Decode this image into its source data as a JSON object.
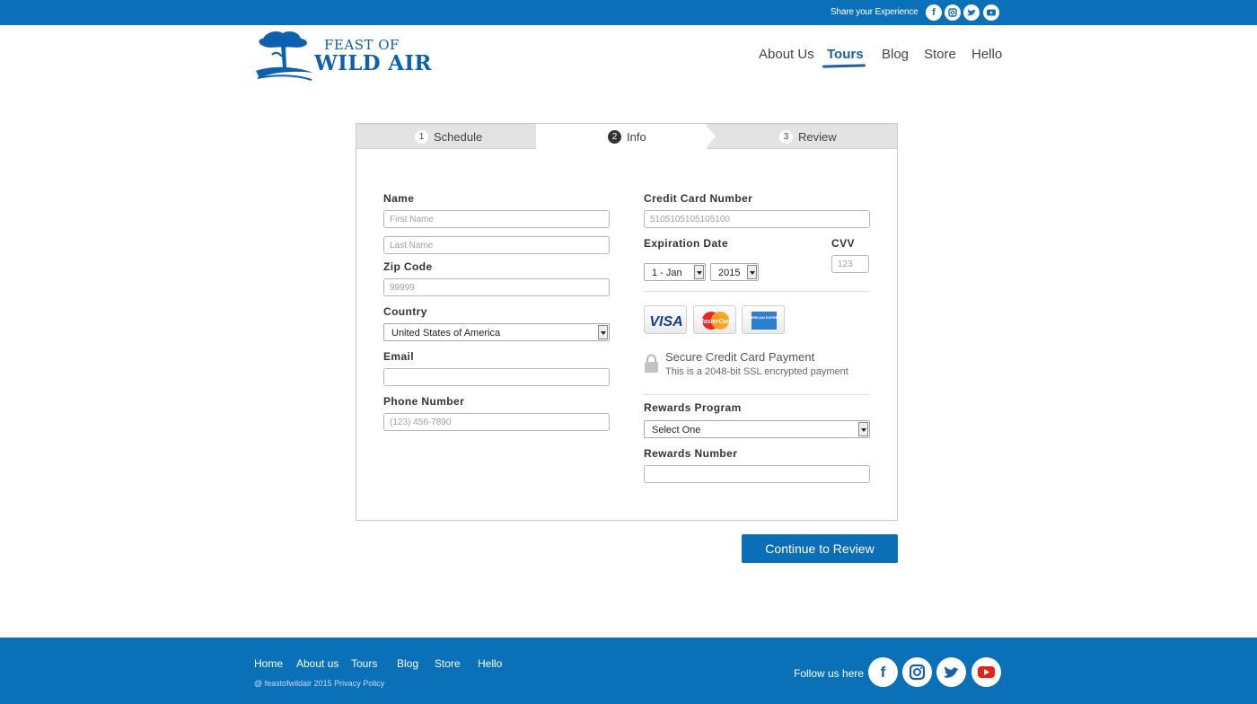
{
  "topbar": {
    "share_text": "Share your Experience",
    "icons": [
      "facebook-icon",
      "instagram-icon",
      "twitter-icon",
      "youtube-icon"
    ]
  },
  "brand": {
    "line1": "FEAST OF",
    "line2": "WILD AIR",
    "color": "#0d5fb0"
  },
  "nav": {
    "items": [
      "About Us",
      "Tours",
      "Blog",
      "Store",
      "Hello"
    ],
    "active": "Tours"
  },
  "steps": [
    {
      "num": "1",
      "label": "Schedule"
    },
    {
      "num": "2",
      "label": "Info",
      "active": true
    },
    {
      "num": "3",
      "label": "Review"
    }
  ],
  "form": {
    "name_label": "Name",
    "first_placeholder": "First Name",
    "last_placeholder": "Last Name",
    "zip_label": "Zip Code",
    "zip_placeholder": "99999",
    "country_label": "Country",
    "country_value": "United States of America",
    "email_label": "Email",
    "email_placeholder": "",
    "phone_label": "Phone Number",
    "phone_placeholder": "(123) 456-7890",
    "cc_label": "Credit Card Number",
    "cc_placeholder": "5105105105105100",
    "exp_label": "Expiration Date",
    "exp_month": "1 - Jan",
    "exp_year": "2015",
    "cvv_label": "CVV",
    "cvv_placeholder": "123",
    "cards": {
      "visa": "VISA",
      "mastercard": "MasterCard",
      "amex": "AMERICAN EXPRESS"
    },
    "secure_title": "Secure Credit Card Payment",
    "secure_sub": "This is a 2048-bit SSL encrypted payment",
    "rewards_label": "Rewards Program",
    "rewards_value": "Select One",
    "rewards_num_label": "Rewards Number",
    "rewards_num_placeholder": ""
  },
  "continue_label": "Continue to Review",
  "footer": {
    "links": [
      "Home",
      "About us",
      "Tours",
      "Blog",
      "Store",
      "Hello"
    ],
    "copyright": "@ feastofwildair 2015 Privacy Policy",
    "follow_text": "Follow us here",
    "icons": [
      "facebook-icon",
      "instagram-icon",
      "twitter-icon",
      "youtube-icon"
    ]
  },
  "colors": {
    "brand_blue": "#0a70b8",
    "youtube_red": "#e62117"
  }
}
